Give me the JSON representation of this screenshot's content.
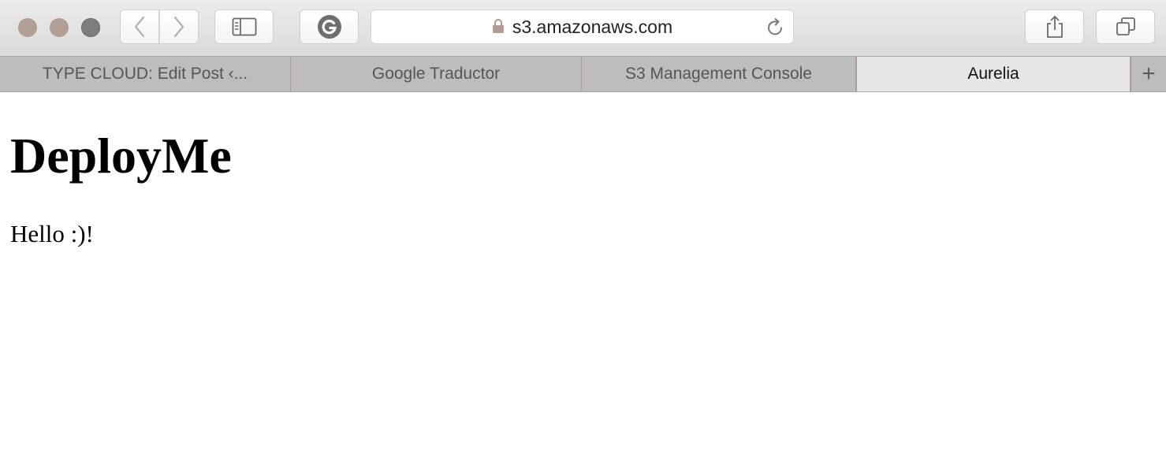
{
  "browser": {
    "address_bar": {
      "url": "s3.amazonaws.com"
    },
    "tabs": [
      {
        "label": "TYPE CLOUD: Edit Post ‹...",
        "active": false
      },
      {
        "label": "Google Traductor",
        "active": false
      },
      {
        "label": "S3 Management Console",
        "active": false
      },
      {
        "label": "Aurelia",
        "active": true
      }
    ],
    "new_tab_label": "+",
    "icons": {
      "back": "chevron-left-icon",
      "forward": "chevron-right-icon",
      "sidebar": "sidebar-icon",
      "extension": "grammarly-icon",
      "lock": "lock-icon",
      "reload": "reload-icon",
      "share": "share-icon",
      "tabs_overview": "tabs-overview-icon"
    }
  },
  "page": {
    "heading": "DeployMe",
    "text": "Hello :)!"
  }
}
